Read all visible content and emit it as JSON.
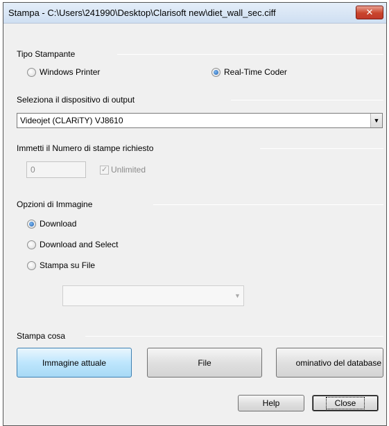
{
  "window": {
    "title": "Stampa  - C:\\Users\\241990\\Desktop\\Clarisoft new\\diet_wall_sec.ciff",
    "close_glyph": "✕"
  },
  "printer_type": {
    "label": "Tipo Stampante",
    "options": [
      "Windows Printer",
      "Real-Time Coder"
    ],
    "selected": "Real-Time Coder"
  },
  "output_device": {
    "label": "Seleziona il dispositivo di output",
    "value": "Videojet (CLARiTY) VJ8610"
  },
  "print_count": {
    "label": "Immetti il Numero di stampe richiesto",
    "value": "0",
    "unlimited_label": "Unlimited",
    "unlimited_checked": true
  },
  "image_options": {
    "label": "Opzioni di Immagine",
    "options": [
      "Download",
      "Download and Select",
      "Stampa su File"
    ],
    "selected": "Download",
    "file_combo_value": ""
  },
  "print_what": {
    "label": "Stampa cosa",
    "buttons": [
      "Immagine attuale",
      "File",
      "ominativo del database"
    ]
  },
  "footer": {
    "help_label": "Help",
    "close_label": "Close"
  },
  "colors": {
    "window_bg": "#f0f0f0",
    "close_button": "#c0392b",
    "focused_button": "#bee6fd"
  }
}
